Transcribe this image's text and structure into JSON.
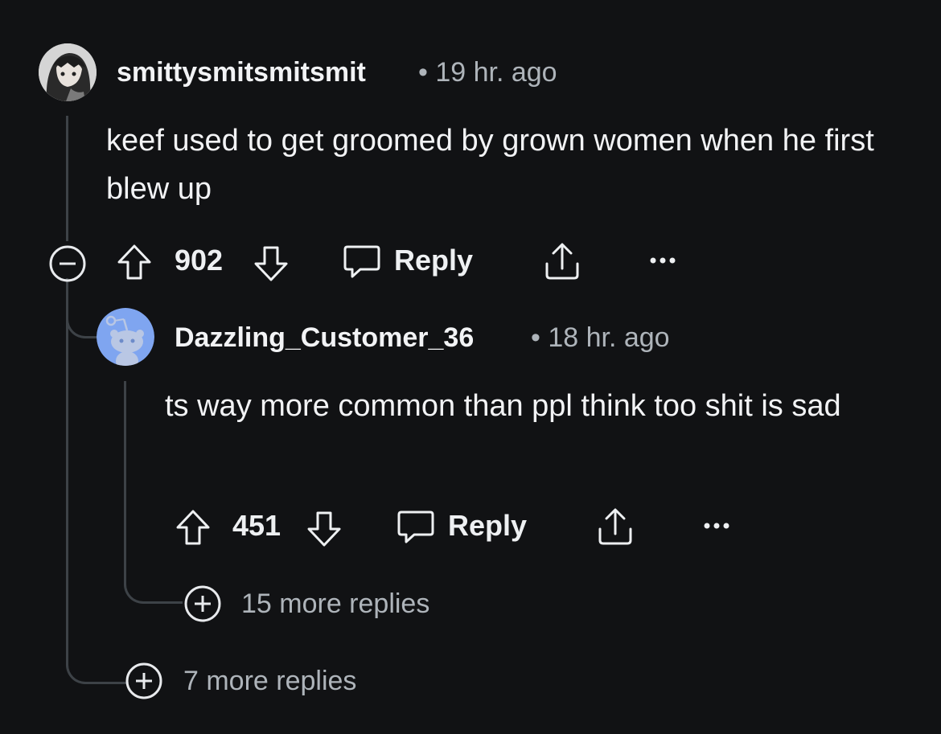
{
  "comment": {
    "username": "smittysmitsmitsmit",
    "time": "• 19 hr. ago",
    "text": "keef used to get groomed by grown women when he first blew up",
    "score": "902",
    "reply_label": "Reply",
    "avatar_icon": "anime-avatar-icon"
  },
  "reply": {
    "username": "Dazzling_Customer_36",
    "time": "• 18 hr. ago",
    "text": "ts way more common than ppl think too shit is sad",
    "score": "451",
    "reply_label": "Reply",
    "avatar_icon": "snoo-avatar-icon",
    "more_replies": "15 more replies"
  },
  "thread": {
    "more_replies": "7 more replies"
  },
  "colors": {
    "background": "#111214",
    "text": "#f2f3f5",
    "muted": "#aeb4ba",
    "thread_line": "#3d4247",
    "snoo_bg": "#7fa5f0"
  }
}
